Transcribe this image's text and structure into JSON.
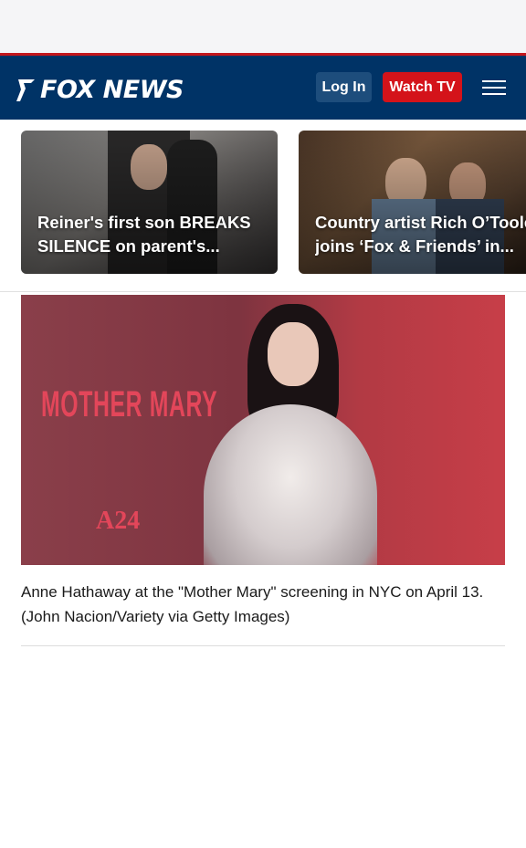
{
  "header": {
    "logo_text": "FOX NEWS",
    "login_label": "Log In",
    "watch_label": "Watch TV",
    "colors": {
      "background": "#003366",
      "accent_red": "#d4131a",
      "login_bg": "#1d4d7c"
    }
  },
  "carousel": {
    "cards": [
      {
        "title": "Reiner's first son BREAKS SILENCE on parent's...",
        "line1": "Reiner's first son BREAKS",
        "line2": "SILENCE on parent's..."
      },
      {
        "title": "Country artist Rich O'Toole joins 'Fox & Friends' in...",
        "line1": "Country artist Rich O’Toole",
        "line2": "joins ‘Fox & Friends’ in..."
      }
    ]
  },
  "article": {
    "image_text_mother": "MOTHER MARY",
    "image_text_a24": "A24",
    "caption": "Anne Hathaway at the \"Mother Mary\" screening in NYC on April 13. (John Nacion/Variety via Getty Images)"
  }
}
